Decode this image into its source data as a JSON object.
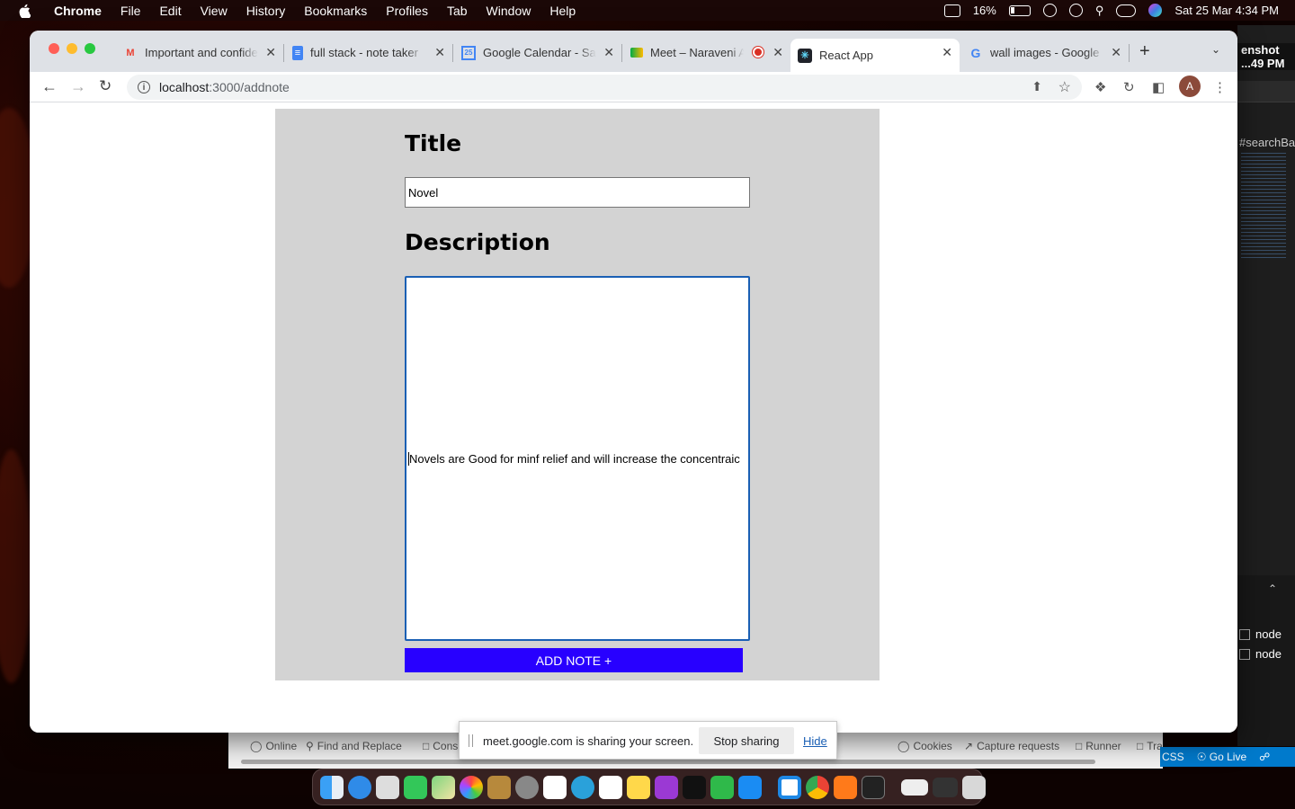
{
  "menubar": {
    "app_name": "Chrome",
    "items": [
      "File",
      "Edit",
      "View",
      "History",
      "Bookmarks",
      "Profiles",
      "Tab",
      "Window",
      "Help"
    ],
    "battery": "16%",
    "datetime": "Sat 25 Mar  4:34 PM"
  },
  "background_window": {
    "screenshot_label_1": "enshot",
    "screenshot_label_2": "...49 PM",
    "search_text": "#searchBa",
    "terminal_rows": [
      "node",
      "node"
    ],
    "devtools_items": [
      "Online",
      "Find and Replace",
      "Cons",
      "Cookies",
      "Capture requests",
      "Runner",
      "Tra"
    ],
    "statusbar": [
      "CSS",
      "Go Live"
    ]
  },
  "tabs": [
    {
      "title": "Important and confide",
      "icon": "gmail-icon"
    },
    {
      "title": "full stack - note taker",
      "icon": "docs-icon"
    },
    {
      "title": "Google Calendar - Sat",
      "icon": "calendar-icon"
    },
    {
      "title": "Meet – Naraveni A",
      "icon": "meet-icon"
    },
    {
      "title": "React App",
      "icon": "react-icon"
    },
    {
      "title": "wall images - Google",
      "icon": "google-icon"
    }
  ],
  "address": {
    "host": "localhost",
    "path": ":3000/addnote"
  },
  "profile_initial": "A",
  "form": {
    "title_heading": "Title",
    "title_value": "Novel",
    "description_heading": "Description",
    "description_value": "Novels are Good for minf relief and will increase the concentraic",
    "submit_label": "ADD NOTE +"
  },
  "share_banner": {
    "message": "meet.google.com is sharing your screen.",
    "stop_label": "Stop sharing",
    "hide_label": "Hide"
  },
  "colors": {
    "form_bg": "#d3d3d3",
    "button_bg": "#2800ff",
    "focus_border": "#1a5fb4"
  },
  "dock_apps": [
    "finder-icon",
    "safari-icon",
    "launchpad-icon",
    "messages-icon",
    "maps-icon",
    "photos-icon",
    "notes-icon",
    "system-settings-icon",
    "calendar-icon",
    "telegram-icon",
    "reminders-icon",
    "notes-yellow-icon",
    "podcasts-icon",
    "appletv-icon",
    "numbers-icon",
    "appstore-icon",
    "vscode-icon",
    "chrome-icon",
    "sublime-icon",
    "terminal-icon",
    "keyboard-icon",
    "screen-icon",
    "trash-icon"
  ]
}
